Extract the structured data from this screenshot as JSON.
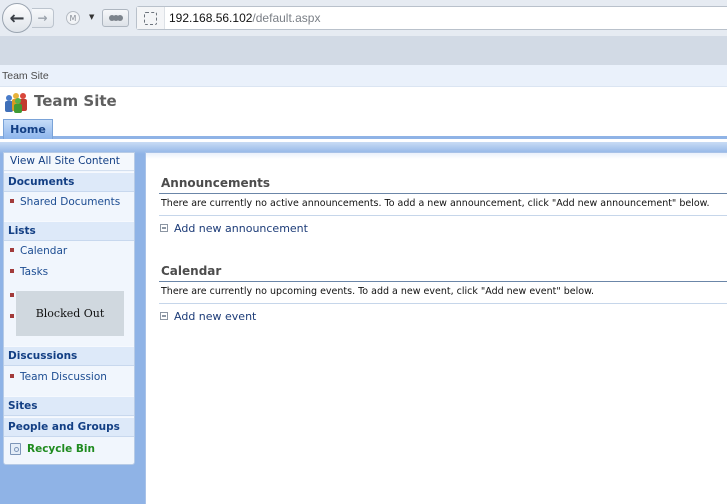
{
  "browser": {
    "url_host": "192.168.56.102",
    "url_path": "/default.aspx",
    "back_icon": "arrow-left-icon",
    "forward_icon": "arrow-right-icon",
    "m_label": "M",
    "dropdown_icon": "chevron-down-icon"
  },
  "breadcrumb": "Team Site",
  "site": {
    "title": "Team Site",
    "logo_icon": "people-group-icon"
  },
  "topnav": {
    "tabs": [
      {
        "label": "Home",
        "selected": true
      }
    ]
  },
  "leftnav": {
    "view_all": "View All Site Content",
    "sections": [
      {
        "header": "Documents",
        "items": [
          "Shared Documents"
        ]
      },
      {
        "header": "Lists",
        "items": [
          "Calendar",
          "Tasks"
        ]
      },
      {
        "header": "Discussions",
        "items": [
          "Team Discussion"
        ]
      },
      {
        "header": "Sites",
        "items": []
      },
      {
        "header": "People and Groups",
        "items": []
      }
    ],
    "blocked_label": "Blocked Out",
    "recycle_bin": "Recycle Bin"
  },
  "webparts": [
    {
      "title": "Announcements",
      "message": "There are currently no active announcements. To add a new announcement, click \"Add new announcement\" below.",
      "add_link": "Add new announcement"
    },
    {
      "title": "Calendar",
      "message": "There are currently no upcoming events. To add a new event, click \"Add new event\" below.",
      "add_link": "Add new event"
    }
  ]
}
